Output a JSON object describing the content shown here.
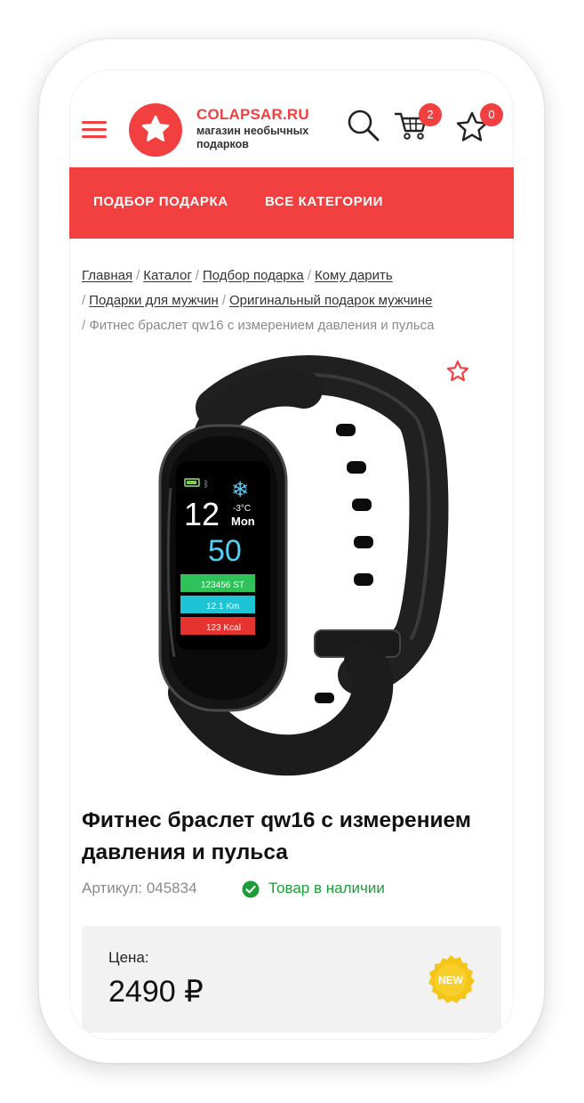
{
  "header": {
    "brand": "COLAPSAR.RU",
    "tagline": "магазин необычных подарков",
    "cart_count": "2",
    "favorites_count": "0",
    "icons": [
      "menu-icon",
      "star-logo-icon",
      "search-icon",
      "cart-icon",
      "star-outline-icon"
    ]
  },
  "nav": {
    "items": [
      "ПОДБОР ПОДАРКА",
      "ВСЕ КАТЕГОРИИ"
    ]
  },
  "breadcrumbs": {
    "links": [
      "Главная",
      "Каталог",
      "Подбор подарка",
      "Кому дарить",
      "Подарки для мужчин",
      "Оригинальный подарок мужчине"
    ],
    "current": "Фитнес браслет qw16 с измерением давления и пульса"
  },
  "product": {
    "title": "Фитнес браслет qw16 с измерением давления и пульса",
    "sku": "Артикул: 045834",
    "stock": "Товар в наличии",
    "price_label": "Цена:",
    "price": "2490 ₽",
    "badge": "NEW",
    "screen": {
      "hour": "12",
      "temp": "-3°C",
      "day": "Mon",
      "pulse": "50",
      "steps": "123456 ST",
      "distance": "12.1 Km",
      "kcal": "123 Kcal"
    }
  },
  "colors": {
    "accent": "#f1403f",
    "in_stock": "#1f9c3a",
    "price_card_bg": "#f2f2f2",
    "new_badge": "#f5c518"
  }
}
